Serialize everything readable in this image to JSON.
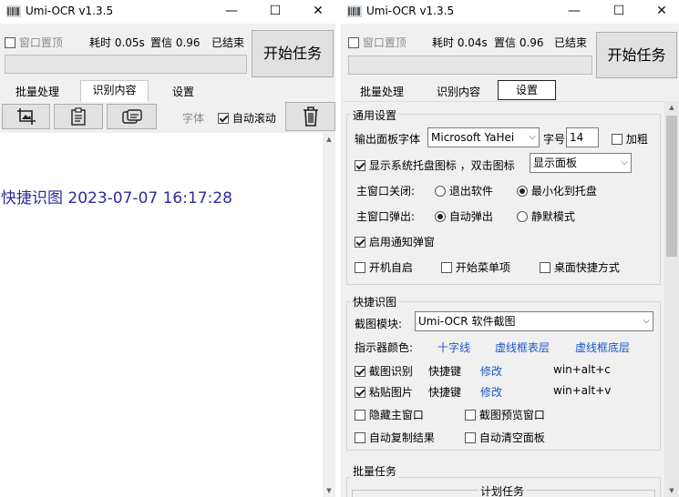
{
  "colors": {
    "link_blue": "#1a56c9",
    "recognized_text": "#2b2b9a",
    "window_bg": "#f0f0f0",
    "button_bg": "#e1e1e1"
  },
  "icons": {
    "app": "umi-ocr-app-icon",
    "minimize": "minimize-icon",
    "maximize": "maximize-icon",
    "close": "close-icon"
  },
  "window_title": "Umi-OCR v1.3.5",
  "caption": {
    "minimize": "—",
    "maximize": "☐",
    "close": "✕"
  },
  "left": {
    "status": {
      "topmost_label": "窗口置顶",
      "time_label": "耗时 0.05s",
      "confidence_label": "置信 0.96",
      "state_label": "已结束"
    },
    "start_button": "开始任务",
    "tabs": [
      "批量处理",
      "识别内容",
      "设置"
    ],
    "toolbar": {
      "font_label": "字体",
      "auto_scroll_label": "自动滚动"
    },
    "recognized_text": "快捷识图 2023-07-07 16:17:28"
  },
  "right": {
    "status": {
      "topmost_label": "窗口置顶",
      "time_label": "耗时 0.04s",
      "confidence_label": "置信 0.96",
      "state_label": "已结束"
    },
    "start_button": "开始任务",
    "tabs": [
      "批量处理",
      "识别内容",
      "设置"
    ],
    "general": {
      "title": "通用设置",
      "font_label": "输出面板字体",
      "font_value": "Microsoft YaHei",
      "size_label": "字号",
      "size_value": "14",
      "bold_label": "加粗",
      "tray_label": "显示系统托盘图标 ，双击图标",
      "tray_action": "显示面板",
      "close_label": "主窗口关闭:",
      "close_exit": "退出软件",
      "close_minimize": "最小化到托盘",
      "popup_label": "主窗口弹出:",
      "popup_auto": "自动弹出",
      "popup_silent": "静默模式",
      "notify_label": "启用通知弹窗",
      "autostart_label": "开机自启",
      "startmenu_label": "开始菜单项",
      "desktop_label": "桌面快捷方式"
    },
    "screenshot": {
      "title": "快捷识图",
      "module_label": "截图模块:",
      "module_value": "Umi-OCR 软件截图",
      "indicator_label": "指示器颜色:",
      "indicator_cross": "十字线",
      "indicator_top": "虚线框表层",
      "indicator_bottom": "虚线框底层",
      "capture_label": "截图识别",
      "hotkey_label": "快捷键",
      "modify_label": "修改",
      "capture_hotkey": "win+alt+c",
      "paste_label": "粘贴图片",
      "paste_hotkey": "win+alt+v",
      "hide_main_label": "隐藏主窗口",
      "preview_label": "截图预览窗口",
      "auto_copy_label": "自动复制结果",
      "auto_clear_label": "自动清空面板"
    },
    "batch": {
      "title": "批量任务",
      "scheduled_label": "计划任务"
    }
  }
}
